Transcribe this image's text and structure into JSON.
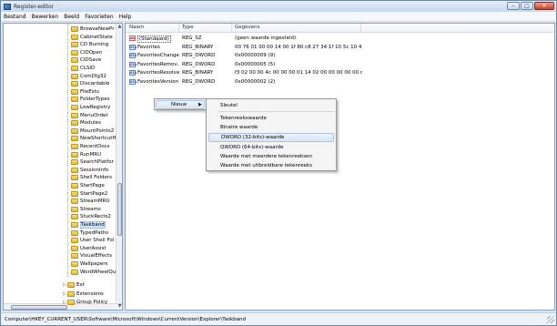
{
  "window": {
    "title": "Register-editor",
    "min": "–",
    "max": "□",
    "close": "✕"
  },
  "menu": [
    {
      "label": "Bestand"
    },
    {
      "label": "Bewerken"
    },
    {
      "label": "Beeld"
    },
    {
      "label": "Favorieten"
    },
    {
      "label": "Help"
    }
  ],
  "tree": {
    "items": [
      "BrowseNewPr",
      "CabinetState",
      "CD Burning",
      "CIDOpen",
      "CIDSave",
      "CLSID",
      "ComDlg32",
      "Discardable",
      "FileExts",
      "FolderTypes",
      "LowRegistry",
      "MenuOrder",
      "Modules",
      "MountPoints2",
      "NewShortcutH",
      "RecentDocs",
      "RunMRU",
      "SearchPlatfor",
      "SessionInfo",
      "Shell Folders",
      "StartPage",
      "StartPage2",
      "StreamMRU",
      "Streams",
      "StuckRects2",
      "Taskband",
      "TypedPaths",
      "User Shell Fol",
      "UserAssist",
      "VisualEffects",
      "Wallpapers",
      "WordWheelQu"
    ],
    "selected": "Taskband",
    "bottom_items": [
      "Ext",
      "Extensions",
      "Group Policy"
    ]
  },
  "values": {
    "headers": {
      "name": "Naam",
      "type": "Type",
      "data": "Gegevens"
    },
    "rows": [
      {
        "name": "(Standaard)",
        "type": "REG_SZ",
        "data": "(geen waarde ingesteld)",
        "icon": "ab"
      },
      {
        "name": "Favorites",
        "type": "REG_BINARY",
        "data": "00 76 01 00 00 14 00 1f 80 c8 27 34 1f 10 5c 10 42 aa ...",
        "icon": "bin"
      },
      {
        "name": "FavoritesChanges",
        "type": "REG_DWORD",
        "data": "0x00000009 (9)",
        "icon": "bin"
      },
      {
        "name": "FavoritesRemov...",
        "type": "REG_DWORD",
        "data": "0x00000005 (5)",
        "icon": "bin"
      },
      {
        "name": "FavoritesResolve",
        "type": "REG_BINARY",
        "data": "f3 02 00 00 4c 00 00 00 01 14 02 00 00 00 00 00 c0 00...",
        "icon": "bin"
      },
      {
        "name": "FavoritesVersion",
        "type": "REG_DWORD",
        "data": "0x00000002 (2)",
        "icon": "bin"
      }
    ]
  },
  "context_menu": {
    "parent_label": "Nieuw",
    "parent_arrow": "▶",
    "sub_items": [
      "Sleutel",
      "Tekenreekswaarde",
      "Binaire waarde",
      "DWORD (32-bits)-waarde",
      "QWORD (64-bits)-waarde",
      "Waarde met meerdere tekenreeksen",
      "Waarde met uitbreidbare tekenreeks"
    ],
    "highlighted": "DWORD (32-bits)-waarde"
  },
  "statusbar": {
    "path": "Computer\\HKEY_CURRENT_USER\\Software\\Microsoft\\Windows\\CurrentVersion\\Explorer\\Taskband"
  }
}
